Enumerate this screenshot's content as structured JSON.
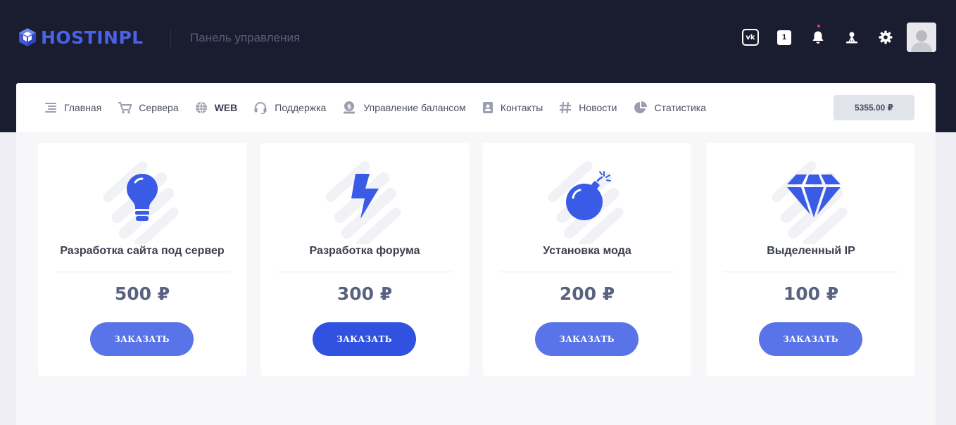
{
  "header": {
    "logo_text": "HOSTINPL",
    "panel_title": "Панель управления",
    "icons": {
      "vk": "vk-icon",
      "counter_value": "1",
      "bell": "bell-icon",
      "network": "network-icon",
      "settings": "gear-icon",
      "avatar": "avatar"
    }
  },
  "nav": {
    "items": [
      {
        "label": "Главная",
        "icon": "list-icon"
      },
      {
        "label": "Сервера",
        "icon": "cart-icon"
      },
      {
        "label": "WEB",
        "icon": "globe-icon"
      },
      {
        "label": "Поддержка",
        "icon": "headset-icon"
      },
      {
        "label": "Управление балансом",
        "icon": "money-icon"
      },
      {
        "label": "Контакты",
        "icon": "contact-icon"
      },
      {
        "label": "Новости",
        "icon": "hash-icon"
      },
      {
        "label": "Статистика",
        "icon": "pie-chart-icon"
      }
    ],
    "active_index": 2,
    "balance": "5355.00 ₽"
  },
  "cards": [
    {
      "title": "Разработка сайта под сервер",
      "price": "500 ₽",
      "button": "ЗАКАЗАТЬ",
      "icon": "lightbulb-icon"
    },
    {
      "title": "Разработка форума",
      "price": "300 ₽",
      "button": "ЗАКАЗАТЬ",
      "icon": "lightning-icon"
    },
    {
      "title": "Установка мода",
      "price": "200 ₽",
      "button": "ЗАКАЗАТЬ",
      "icon": "bomb-icon"
    },
    {
      "title": "Выделенный IP",
      "price": "100 ₽",
      "button": "ЗАКАЗАТЬ",
      "icon": "diamond-icon"
    }
  ],
  "colors": {
    "header_bg": "#1a1c30",
    "accent": "#4a62e6",
    "button": "#5973e8",
    "button_active": "#3152e0"
  }
}
